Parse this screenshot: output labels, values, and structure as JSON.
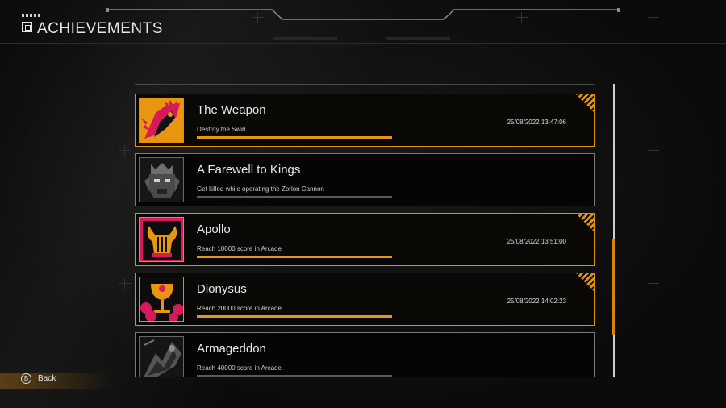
{
  "header": {
    "title": "ACHIEVEMENTS"
  },
  "achievements": [
    {
      "title": "The Weapon",
      "description": "Destroy the Swirl",
      "date": "25/08/2022 13:47:06",
      "unlocked": true,
      "progress": 1.0,
      "icon": "weapon-icon"
    },
    {
      "title": "A Farewell to Kings",
      "description": "Get killed while operating the Zorlon Cannon",
      "date": "",
      "unlocked": false,
      "progress": 0.0,
      "icon": "king-mask-icon"
    },
    {
      "title": "Apollo",
      "description": "Reach 10000 score in Arcade",
      "date": "25/08/2022 13:51:00",
      "unlocked": true,
      "progress": 1.0,
      "icon": "lyre-icon"
    },
    {
      "title": "Dionysus",
      "description": "Reach 20000 score in Arcade",
      "date": "25/08/2022 14:02:23",
      "unlocked": true,
      "progress": 1.0,
      "icon": "goblet-icon"
    },
    {
      "title": "Armageddon",
      "description": "Reach 40000 score in Arcade",
      "date": "",
      "unlocked": false,
      "progress": 0.0,
      "icon": "armageddon-icon"
    }
  ],
  "footer": {
    "back_button": "B",
    "back_label": "Back"
  },
  "colors": {
    "accent": "#e0900f",
    "locked": "#7a7a7a",
    "background": "#0b0b0b"
  }
}
